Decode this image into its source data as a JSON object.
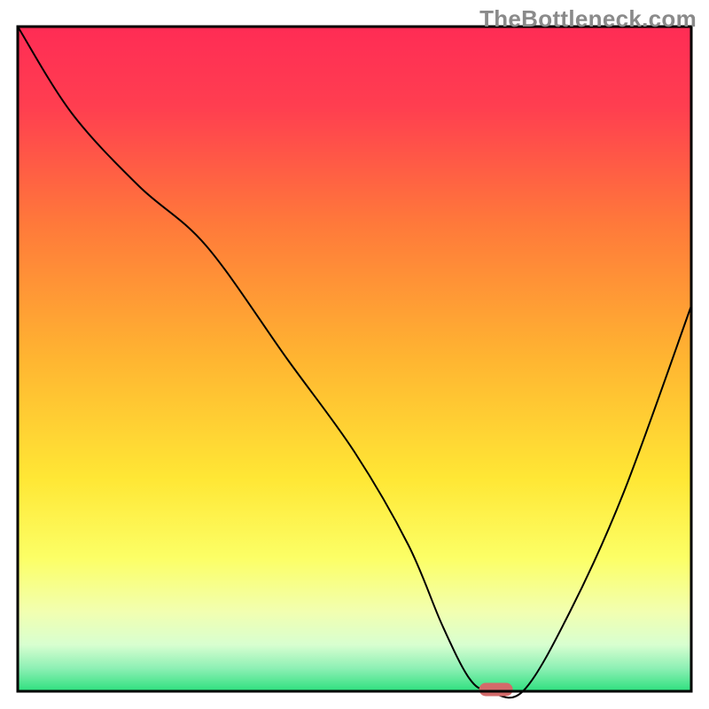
{
  "watermark": "TheBottleneck.com",
  "chart_data": {
    "type": "line",
    "title": "",
    "xlabel": "",
    "ylabel": "",
    "xlim": [
      0,
      100
    ],
    "ylim": [
      0,
      100
    ],
    "grid": false,
    "legend": false,
    "series": [
      {
        "name": "bottleneck-curve",
        "x": [
          0,
          8,
          18,
          28,
          40,
          50,
          58,
          63,
          67,
          70,
          75,
          82,
          90,
          100
        ],
        "y": [
          100,
          87,
          76,
          67,
          50,
          36,
          22,
          10,
          2,
          0,
          0,
          12,
          30,
          58
        ]
      }
    ],
    "marker": {
      "name": "optimal-region",
      "x": 71,
      "y": 0,
      "width": 5,
      "height": 2,
      "color": "#d46a6a"
    },
    "gradient_stops": [
      {
        "offset": 0.0,
        "color": "#ff2c55"
      },
      {
        "offset": 0.12,
        "color": "#ff3e50"
      },
      {
        "offset": 0.3,
        "color": "#ff7a3a"
      },
      {
        "offset": 0.5,
        "color": "#ffb531"
      },
      {
        "offset": 0.68,
        "color": "#ffe735"
      },
      {
        "offset": 0.8,
        "color": "#fcff66"
      },
      {
        "offset": 0.88,
        "color": "#f2ffb0"
      },
      {
        "offset": 0.93,
        "color": "#d8ffd0"
      },
      {
        "offset": 0.965,
        "color": "#8ef0b5"
      },
      {
        "offset": 1.0,
        "color": "#2ee07e"
      }
    ],
    "border_color": "#000000",
    "border_width": 3,
    "line_color": "#000000",
    "line_width": 2
  }
}
